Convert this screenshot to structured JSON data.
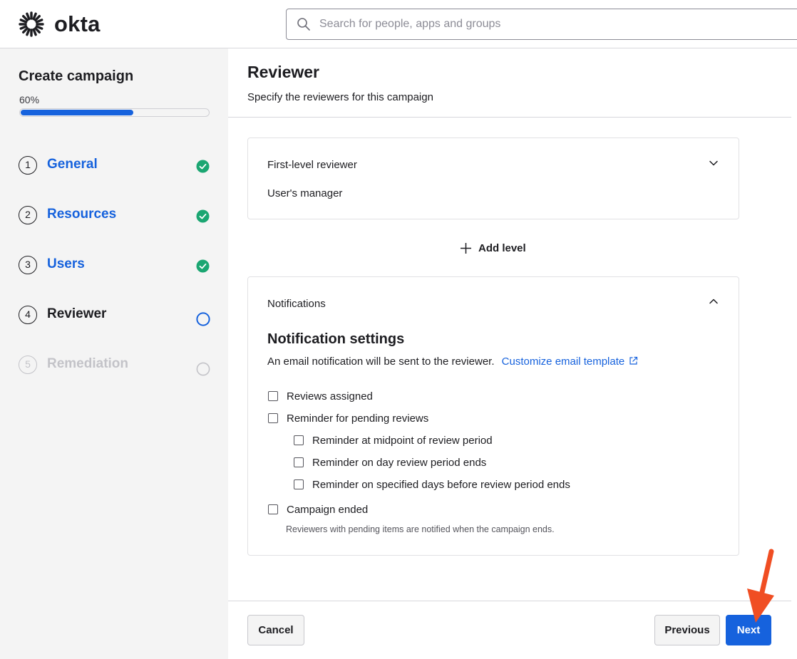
{
  "app": {
    "logo_text": "okta"
  },
  "search": {
    "placeholder": "Search for people, apps and groups"
  },
  "sidebar": {
    "title": "Create campaign",
    "progress_label": "60%",
    "progress_value": 0.6,
    "steps": [
      {
        "number": "1",
        "label": "General",
        "status": "complete"
      },
      {
        "number": "2",
        "label": "Resources",
        "status": "complete"
      },
      {
        "number": "3",
        "label": "Users",
        "status": "complete"
      },
      {
        "number": "4",
        "label": "Reviewer",
        "status": "current"
      },
      {
        "number": "5",
        "label": "Remediation",
        "status": "upcoming"
      }
    ]
  },
  "main": {
    "title": "Reviewer",
    "subtitle": "Specify the reviewers for this campaign",
    "reviewer_card": {
      "label": "First-level reviewer",
      "value": "User's manager"
    },
    "add_level_label": "Add level",
    "notifications_card": {
      "label": "Notifications",
      "heading": "Notification settings",
      "description": "An email notification will be sent to the reviewer.",
      "link_label": "Customize email template",
      "options": [
        {
          "label": "Reviews assigned",
          "checked": false
        },
        {
          "label": "Reminder for pending reviews",
          "checked": false
        },
        {
          "label": "Reminder at midpoint of review period",
          "checked": false
        },
        {
          "label": "Reminder on day review period ends",
          "checked": false
        },
        {
          "label": "Reminder on specified days before review period ends",
          "checked": false
        },
        {
          "label": "Campaign ended",
          "checked": false
        }
      ],
      "campaign_ended_hint": "Reviewers with pending items are notified when the campaign ends."
    }
  },
  "footer": {
    "cancel_label": "Cancel",
    "previous_label": "Previous",
    "next_label": "Next"
  },
  "colors": {
    "accent": "#1662dd",
    "success": "#1ba672",
    "annotation_arrow": "#f04e23"
  }
}
